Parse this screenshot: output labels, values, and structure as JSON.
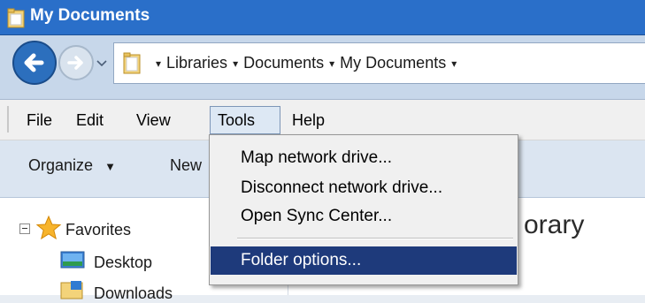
{
  "window": {
    "title": "My Documents"
  },
  "address": {
    "breadcrumbs": [
      "Libraries",
      "Documents",
      "My Documents"
    ]
  },
  "menubar": {
    "items": [
      {
        "label": "File"
      },
      {
        "label": "Edit"
      },
      {
        "label": "View"
      },
      {
        "label": "Tools",
        "active": true
      },
      {
        "label": "Help"
      }
    ]
  },
  "commandbar": {
    "organize_label": "Organize",
    "new_label": "New"
  },
  "navpane": {
    "favorites_label": "Favorites",
    "items": [
      {
        "label": "Desktop"
      },
      {
        "label": "Downloads"
      }
    ]
  },
  "content": {
    "library_title_partial": "orary"
  },
  "tools_menu": {
    "items": [
      {
        "label": "Map network drive..."
      },
      {
        "label": "Disconnect network drive..."
      },
      {
        "label": "Open Sync Center..."
      },
      {
        "label": "Folder options...",
        "highlighted": true
      }
    ]
  },
  "colors": {
    "titlebar": "#2a6fc9",
    "menu_highlight": "#1e3a7b",
    "active_menu_bg": "#dde8f4"
  },
  "icons": [
    "folder-icon",
    "back-arrow-icon",
    "forward-arrow-icon",
    "history-chevron-icon",
    "star-icon",
    "desktop-icon",
    "downloads-icon",
    "dropdown-arrow-icon"
  ]
}
